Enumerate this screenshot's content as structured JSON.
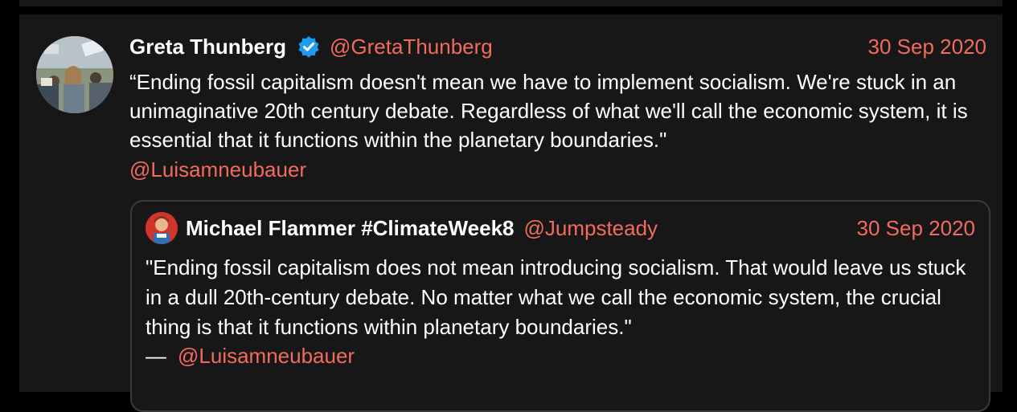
{
  "tweet": {
    "author_name": "Greta Thunberg",
    "handle": "@GretaThunberg",
    "date": "30 Sep 2020",
    "text": "“Ending fossil capitalism doesn't mean we have to implement socialism. We're stuck in an unimaginative 20th century debate. Regardless of what we'll call the economic system, it is essential that it functions within the planetary boundaries.\"",
    "mention": "@Luisamneubauer",
    "verified_icon": "verified-badge-icon",
    "accent_color": "#f26b5e",
    "badge_color": "#1d9bf0"
  },
  "quote": {
    "author_name": "Michael Flammer #ClimateWeek8",
    "handle": "@Jumpsteady",
    "date": "30 Sep 2020",
    "text": "\"Ending fossil capitalism does not mean introducing socialism. That would leave us stuck in a dull 20th-century debate. No matter what we call the economic system, the crucial thing is that it functions within planetary boundaries.\"",
    "dash": "—",
    "mention": "@Luisamneubauer"
  }
}
